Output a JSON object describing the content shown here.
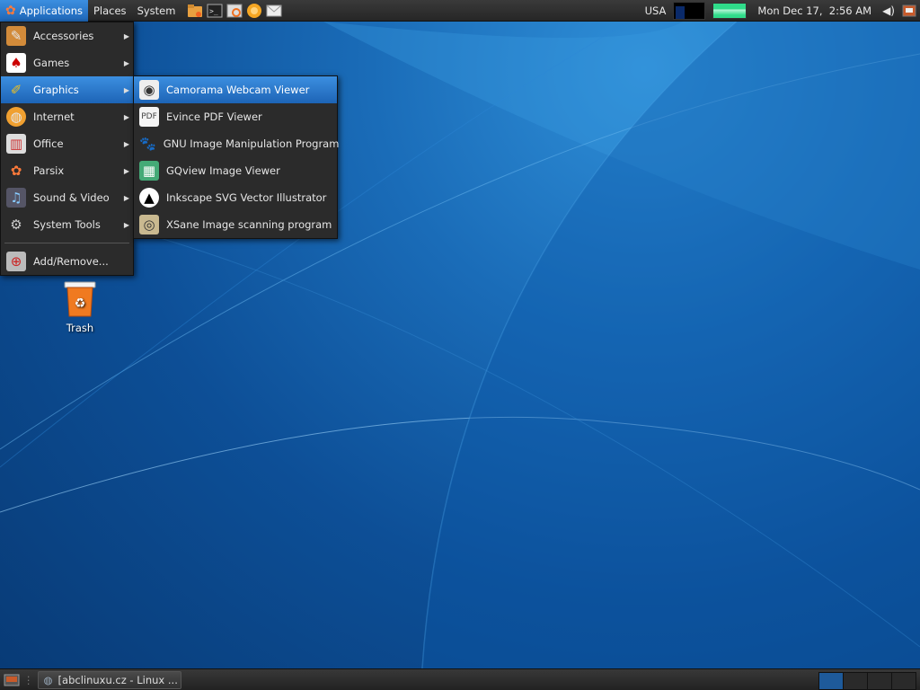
{
  "top_panel": {
    "menus": [
      "Applications",
      "Places",
      "System"
    ],
    "keyboard_layout": "USA",
    "clock": "Mon Dec 17,  2:56 AM",
    "launchers": [
      "file-manager-icon",
      "terminal-icon",
      "image-viewer-icon",
      "browser-icon",
      "mail-icon"
    ]
  },
  "applications_menu": {
    "items": [
      {
        "label": "Accessories",
        "icon": "accessories-icon",
        "submenu": true
      },
      {
        "label": "Games",
        "icon": "games-icon",
        "submenu": true
      },
      {
        "label": "Graphics",
        "icon": "graphics-icon",
        "submenu": true,
        "active": true
      },
      {
        "label": "Internet",
        "icon": "internet-icon",
        "submenu": true
      },
      {
        "label": "Office",
        "icon": "office-icon",
        "submenu": true
      },
      {
        "label": "Parsix",
        "icon": "parsix-icon",
        "submenu": true
      },
      {
        "label": "Sound & Video",
        "icon": "sound-video-icon",
        "submenu": true
      },
      {
        "label": "System Tools",
        "icon": "system-tools-icon",
        "submenu": true
      }
    ],
    "add_remove": "Add/Remove..."
  },
  "graphics_menu": {
    "items": [
      {
        "label": "Camorama Webcam Viewer",
        "icon": "webcam-icon",
        "active": true
      },
      {
        "label": "Evince PDF Viewer",
        "icon": "pdf-viewer-icon"
      },
      {
        "label": "GNU Image Manipulation Program",
        "icon": "gimp-icon"
      },
      {
        "label": "GQview Image Viewer",
        "icon": "gqview-icon"
      },
      {
        "label": "Inkscape SVG Vector Illustrator",
        "icon": "inkscape-icon"
      },
      {
        "label": "XSane Image scanning program",
        "icon": "xsane-icon"
      }
    ]
  },
  "desktop": {
    "trash_label": "Trash"
  },
  "bottom_panel": {
    "task": "[abclinuxu.cz - Linux ...",
    "workspaces": 4,
    "active_workspace": 1
  },
  "colors": {
    "highlight": "#2a7ad0",
    "panel": "#2e2e2e",
    "menu_bg": "#2b2b2b",
    "desktop": "#0d4f97"
  }
}
